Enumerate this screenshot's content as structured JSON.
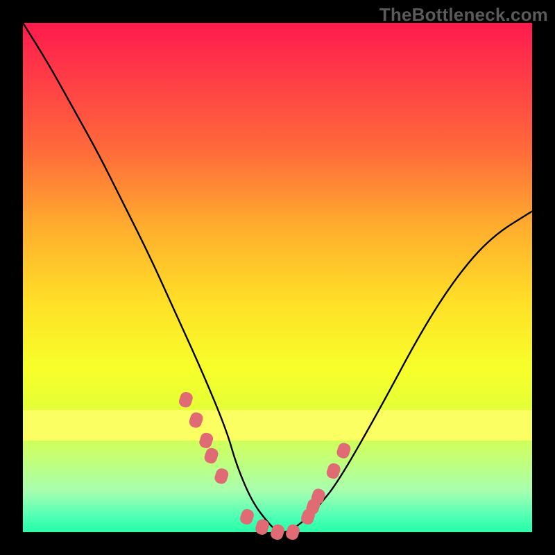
{
  "watermark": "TheBottleneck.com",
  "chart_data": {
    "type": "line",
    "title": "",
    "xlabel": "",
    "ylabel": "",
    "xlim": [
      0,
      100
    ],
    "ylim": [
      0,
      100
    ],
    "grid": false,
    "legend": false,
    "background_gradient": [
      "#ff1a4d",
      "#ffad2e",
      "#fcff61",
      "#25ffa8"
    ],
    "series": [
      {
        "name": "bottleneck-curve",
        "color": "#000000",
        "x": [
          0,
          5,
          10,
          15,
          20,
          25,
          30,
          35,
          40,
          42,
          45,
          48,
          50,
          52,
          55,
          58,
          62,
          70,
          78,
          85,
          92,
          100
        ],
        "y": [
          100,
          92,
          83,
          74,
          64,
          54,
          43,
          32,
          20,
          13,
          6,
          2,
          0,
          0,
          2,
          5,
          10,
          24,
          39,
          50,
          58,
          63
        ]
      },
      {
        "name": "marker-cluster",
        "type": "scatter",
        "color": "#e06b74",
        "x": [
          32,
          34,
          36,
          37,
          39,
          44,
          47,
          50,
          53,
          56,
          57,
          58,
          61,
          63
        ],
        "y": [
          26,
          22,
          18,
          15,
          11,
          3,
          1,
          0,
          0,
          3,
          5,
          7,
          12,
          16
        ]
      }
    ],
    "overlay_band": {
      "color": "#fcff61",
      "y_from": 18,
      "y_to": 24
    }
  }
}
